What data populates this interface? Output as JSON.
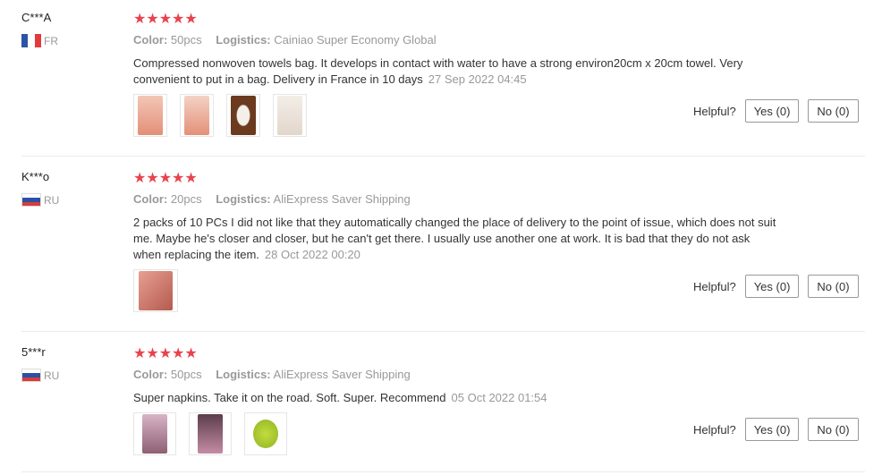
{
  "reviews": [
    {
      "user": "C***A",
      "country": "FR",
      "stars": "★★★★★",
      "color_label": "Color:",
      "color_value": "50pcs",
      "logistics_label": "Logistics:",
      "logistics_value": "Cainiao Super Economy Global",
      "text": "Compressed nonwoven towels bag. It develops in contact with water to have a strong environ20cm x 20cm towel. Very convenient to put in a bag. Delivery in France in 10 days",
      "date": "27 Sep 2022 04:45",
      "helpful_label": "Helpful?",
      "yes_label": "Yes (0)",
      "no_label": "No (0)",
      "photo_colors": [
        "#e7a48e",
        "#e9a58f",
        "#6b3a1f",
        "#efe5dc"
      ]
    },
    {
      "user": "K***o",
      "country": "RU",
      "stars": "★★★★★",
      "color_label": "Color:",
      "color_value": "20pcs",
      "logistics_label": "Logistics:",
      "logistics_value": "AliExpress Saver Shipping",
      "text": "2 packs of 10 PCs I did not like that they automatically changed the place of delivery to the point of issue, which does not suit me. Maybe he's closer and closer, but he can't get there. I usually use another one at work. It is bad that they do not ask when replacing the item.",
      "date": "28 Oct 2022 00:20",
      "helpful_label": "Helpful?",
      "yes_label": "Yes (0)",
      "no_label": "No (0)",
      "photo_colors": [
        "#c9786a"
      ]
    },
    {
      "user": "5***r",
      "country": "RU",
      "stars": "★★★★★",
      "color_label": "Color:",
      "color_value": "50pcs",
      "logistics_label": "Logistics:",
      "logistics_value": "AliExpress Saver Shipping",
      "text": "Super napkins. Take it on the road. Soft. Super. Recommend",
      "date": "05 Oct 2022 01:54",
      "helpful_label": "Helpful?",
      "yes_label": "Yes (0)",
      "no_label": "No (0)",
      "photo_colors": [
        "#b892a6",
        "#9f7788",
        "#a7c431"
      ]
    }
  ],
  "colors": {
    "star": "#e8434e",
    "muted": "#999999"
  }
}
